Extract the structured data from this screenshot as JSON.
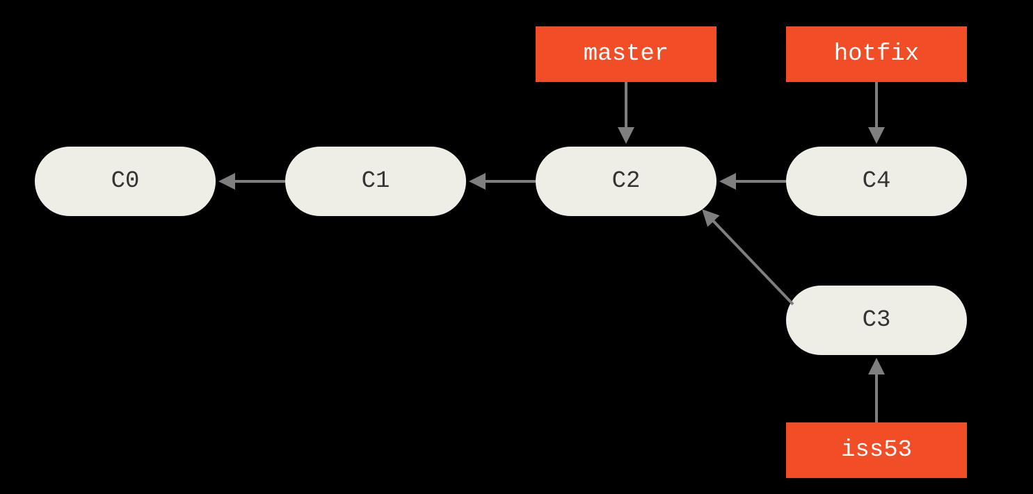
{
  "commits": {
    "c0": "C0",
    "c1": "C1",
    "c2": "C2",
    "c3": "C3",
    "c4": "C4"
  },
  "branches": {
    "master": "master",
    "hotfix": "hotfix",
    "iss53": "iss53"
  },
  "diagram": {
    "description": "Git branch diagram showing commit history. C0 <- C1 <- C2 is the main line. master points to C2. C4 is a child of C2, hotfix points to C4. C3 is a child of C2, iss53 points to C3.",
    "edges": [
      {
        "from": "C1",
        "to": "C0",
        "type": "parent"
      },
      {
        "from": "C2",
        "to": "C1",
        "type": "parent"
      },
      {
        "from": "C4",
        "to": "C2",
        "type": "parent"
      },
      {
        "from": "C3",
        "to": "C2",
        "type": "parent"
      },
      {
        "from": "master",
        "to": "C2",
        "type": "branch-pointer"
      },
      {
        "from": "hotfix",
        "to": "C4",
        "type": "branch-pointer"
      },
      {
        "from": "iss53",
        "to": "C3",
        "type": "branch-pointer"
      }
    ],
    "colors": {
      "commit_bg": "#efeee6",
      "branch_bg": "#f14e27",
      "arrow": "#7f7f7f",
      "background": "#000000"
    }
  }
}
